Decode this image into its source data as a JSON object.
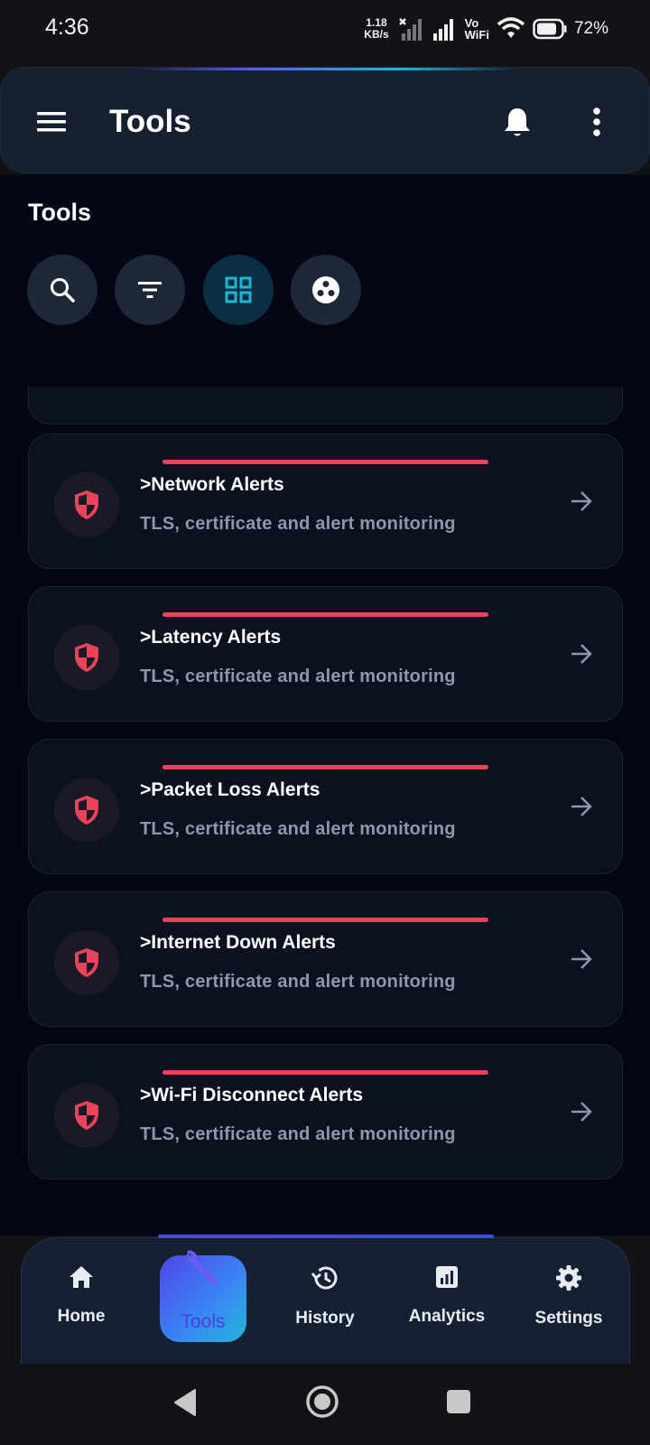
{
  "status_bar": {
    "time": "4:36",
    "speed_value": "1.18",
    "speed_unit": "KB/s",
    "vo_top": "Vo",
    "vo_bottom": "WiFi",
    "battery": "72%"
  },
  "app_bar": {
    "title": "Tools",
    "icons": [
      "menu-icon",
      "bell-icon",
      "more-vert-icon"
    ]
  },
  "section": {
    "title": "Tools",
    "actions": [
      "search-icon",
      "filter-icon",
      "grid-icon",
      "bubbles-icon"
    ],
    "active_action": "grid-icon"
  },
  "alerts": [
    {
      "title": ">Network Alerts",
      "subtitle": "TLS, certificate and alert monitoring"
    },
    {
      "title": ">Latency Alerts",
      "subtitle": "TLS, certificate and alert monitoring"
    },
    {
      "title": ">Packet Loss Alerts",
      "subtitle": "TLS, certificate and alert monitoring"
    },
    {
      "title": ">Internet Down Alerts",
      "subtitle": "TLS, certificate and alert monitoring"
    },
    {
      "title": ">Wi-Fi Disconnect Alerts",
      "subtitle": "TLS, certificate and alert monitoring"
    }
  ],
  "bottom_nav": {
    "home": "Home",
    "tools": "Tools",
    "history": "History",
    "analytics": "Analytics",
    "settings": "Settings",
    "active": "tools"
  },
  "colors": {
    "background": "#030614",
    "card": "#0c1120",
    "accent_red": "#e8435a",
    "accent_cyan": "#1fb6d6",
    "accent_indigo": "#4f46e5"
  }
}
